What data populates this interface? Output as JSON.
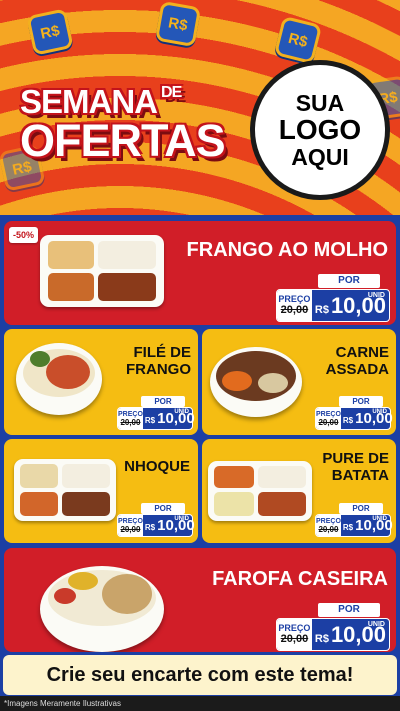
{
  "header": {
    "coin_symbol": "R$",
    "title_line1": "SEMANA",
    "title_de": "DE",
    "title_line2": "OFERTAS",
    "logo_line1": "SUA",
    "logo_line2": "LOGO",
    "logo_line3": "AQUI"
  },
  "products": [
    {
      "name": "FRANGO AO MOLHO",
      "badge": "-50%",
      "por": "POR",
      "preco": "PREÇO",
      "de": "DE",
      "old": "20,00",
      "currency": "R$",
      "price": "10,00",
      "unid": "UNID"
    },
    {
      "name_l1": "FILÉ DE",
      "name_l2": "FRANGO",
      "por": "POR",
      "preco": "PREÇO",
      "de": "DE",
      "old": "20,00",
      "currency": "R$",
      "price": "10,00",
      "unid": "UNID"
    },
    {
      "name_l1": "CARNE",
      "name_l2": "ASSADA",
      "por": "POR",
      "preco": "PREÇO",
      "de": "DE",
      "old": "20,00",
      "currency": "R$",
      "price": "10,00",
      "unid": "UNID"
    },
    {
      "name": "NHOQUE",
      "por": "POR",
      "preco": "PREÇO",
      "de": "DE",
      "old": "20,00",
      "currency": "R$",
      "price": "10,00",
      "unid": "UNID"
    },
    {
      "name_l1": "PURE DE",
      "name_l2": "BATATA",
      "por": "POR",
      "preco": "PREÇO",
      "de": "DE",
      "old": "20,00",
      "currency": "R$",
      "price": "10,00",
      "unid": "UNID"
    },
    {
      "name": "FAROFA CASEIRA",
      "por": "POR",
      "preco": "PREÇO",
      "de": "DE",
      "old": "20,00",
      "currency": "R$",
      "price": "10,00",
      "unid": "UNID"
    }
  ],
  "cta": "Crie seu encarte com este tema!",
  "disclaimer": "*Imagens Meramente Ilustrativas",
  "colors": {
    "red": "#d11e28",
    "yellow": "#f5bd12",
    "blue": "#1c3fa4",
    "orange": "#f5a623"
  }
}
